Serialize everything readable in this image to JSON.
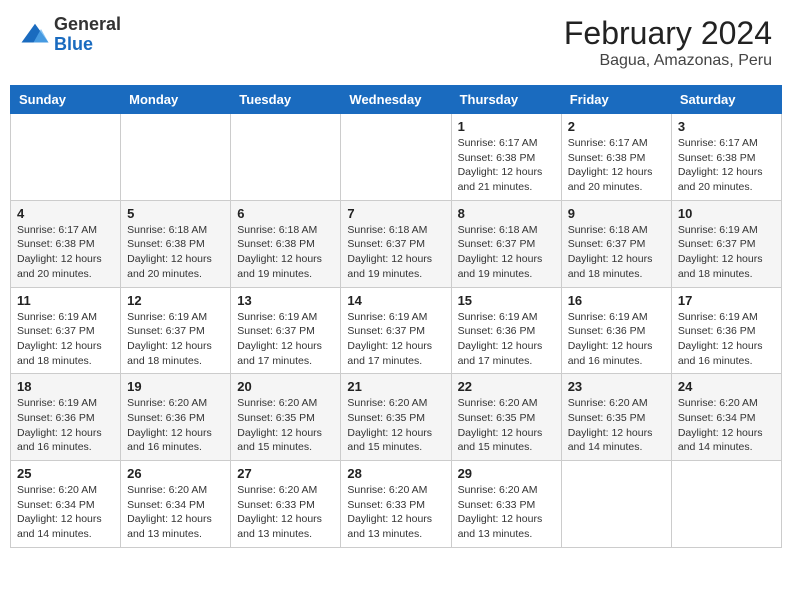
{
  "header": {
    "logo_general": "General",
    "logo_blue": "Blue",
    "main_title": "February 2024",
    "subtitle": "Bagua, Amazonas, Peru"
  },
  "calendar": {
    "days_of_week": [
      "Sunday",
      "Monday",
      "Tuesday",
      "Wednesday",
      "Thursday",
      "Friday",
      "Saturday"
    ],
    "weeks": [
      [
        {
          "day": "",
          "info": ""
        },
        {
          "day": "",
          "info": ""
        },
        {
          "day": "",
          "info": ""
        },
        {
          "day": "",
          "info": ""
        },
        {
          "day": "1",
          "info": "Sunrise: 6:17 AM\nSunset: 6:38 PM\nDaylight: 12 hours and 21 minutes."
        },
        {
          "day": "2",
          "info": "Sunrise: 6:17 AM\nSunset: 6:38 PM\nDaylight: 12 hours and 20 minutes."
        },
        {
          "day": "3",
          "info": "Sunrise: 6:17 AM\nSunset: 6:38 PM\nDaylight: 12 hours and 20 minutes."
        }
      ],
      [
        {
          "day": "4",
          "info": "Sunrise: 6:17 AM\nSunset: 6:38 PM\nDaylight: 12 hours and 20 minutes."
        },
        {
          "day": "5",
          "info": "Sunrise: 6:18 AM\nSunset: 6:38 PM\nDaylight: 12 hours and 20 minutes."
        },
        {
          "day": "6",
          "info": "Sunrise: 6:18 AM\nSunset: 6:38 PM\nDaylight: 12 hours and 19 minutes."
        },
        {
          "day": "7",
          "info": "Sunrise: 6:18 AM\nSunset: 6:37 PM\nDaylight: 12 hours and 19 minutes."
        },
        {
          "day": "8",
          "info": "Sunrise: 6:18 AM\nSunset: 6:37 PM\nDaylight: 12 hours and 19 minutes."
        },
        {
          "day": "9",
          "info": "Sunrise: 6:18 AM\nSunset: 6:37 PM\nDaylight: 12 hours and 18 minutes."
        },
        {
          "day": "10",
          "info": "Sunrise: 6:19 AM\nSunset: 6:37 PM\nDaylight: 12 hours and 18 minutes."
        }
      ],
      [
        {
          "day": "11",
          "info": "Sunrise: 6:19 AM\nSunset: 6:37 PM\nDaylight: 12 hours and 18 minutes."
        },
        {
          "day": "12",
          "info": "Sunrise: 6:19 AM\nSunset: 6:37 PM\nDaylight: 12 hours and 18 minutes."
        },
        {
          "day": "13",
          "info": "Sunrise: 6:19 AM\nSunset: 6:37 PM\nDaylight: 12 hours and 17 minutes."
        },
        {
          "day": "14",
          "info": "Sunrise: 6:19 AM\nSunset: 6:37 PM\nDaylight: 12 hours and 17 minutes."
        },
        {
          "day": "15",
          "info": "Sunrise: 6:19 AM\nSunset: 6:36 PM\nDaylight: 12 hours and 17 minutes."
        },
        {
          "day": "16",
          "info": "Sunrise: 6:19 AM\nSunset: 6:36 PM\nDaylight: 12 hours and 16 minutes."
        },
        {
          "day": "17",
          "info": "Sunrise: 6:19 AM\nSunset: 6:36 PM\nDaylight: 12 hours and 16 minutes."
        }
      ],
      [
        {
          "day": "18",
          "info": "Sunrise: 6:19 AM\nSunset: 6:36 PM\nDaylight: 12 hours and 16 minutes."
        },
        {
          "day": "19",
          "info": "Sunrise: 6:20 AM\nSunset: 6:36 PM\nDaylight: 12 hours and 16 minutes."
        },
        {
          "day": "20",
          "info": "Sunrise: 6:20 AM\nSunset: 6:35 PM\nDaylight: 12 hours and 15 minutes."
        },
        {
          "day": "21",
          "info": "Sunrise: 6:20 AM\nSunset: 6:35 PM\nDaylight: 12 hours and 15 minutes."
        },
        {
          "day": "22",
          "info": "Sunrise: 6:20 AM\nSunset: 6:35 PM\nDaylight: 12 hours and 15 minutes."
        },
        {
          "day": "23",
          "info": "Sunrise: 6:20 AM\nSunset: 6:35 PM\nDaylight: 12 hours and 14 minutes."
        },
        {
          "day": "24",
          "info": "Sunrise: 6:20 AM\nSunset: 6:34 PM\nDaylight: 12 hours and 14 minutes."
        }
      ],
      [
        {
          "day": "25",
          "info": "Sunrise: 6:20 AM\nSunset: 6:34 PM\nDaylight: 12 hours and 14 minutes."
        },
        {
          "day": "26",
          "info": "Sunrise: 6:20 AM\nSunset: 6:34 PM\nDaylight: 12 hours and 13 minutes."
        },
        {
          "day": "27",
          "info": "Sunrise: 6:20 AM\nSunset: 6:33 PM\nDaylight: 12 hours and 13 minutes."
        },
        {
          "day": "28",
          "info": "Sunrise: 6:20 AM\nSunset: 6:33 PM\nDaylight: 12 hours and 13 minutes."
        },
        {
          "day": "29",
          "info": "Sunrise: 6:20 AM\nSunset: 6:33 PM\nDaylight: 12 hours and 13 minutes."
        },
        {
          "day": "",
          "info": ""
        },
        {
          "day": "",
          "info": ""
        }
      ]
    ]
  }
}
